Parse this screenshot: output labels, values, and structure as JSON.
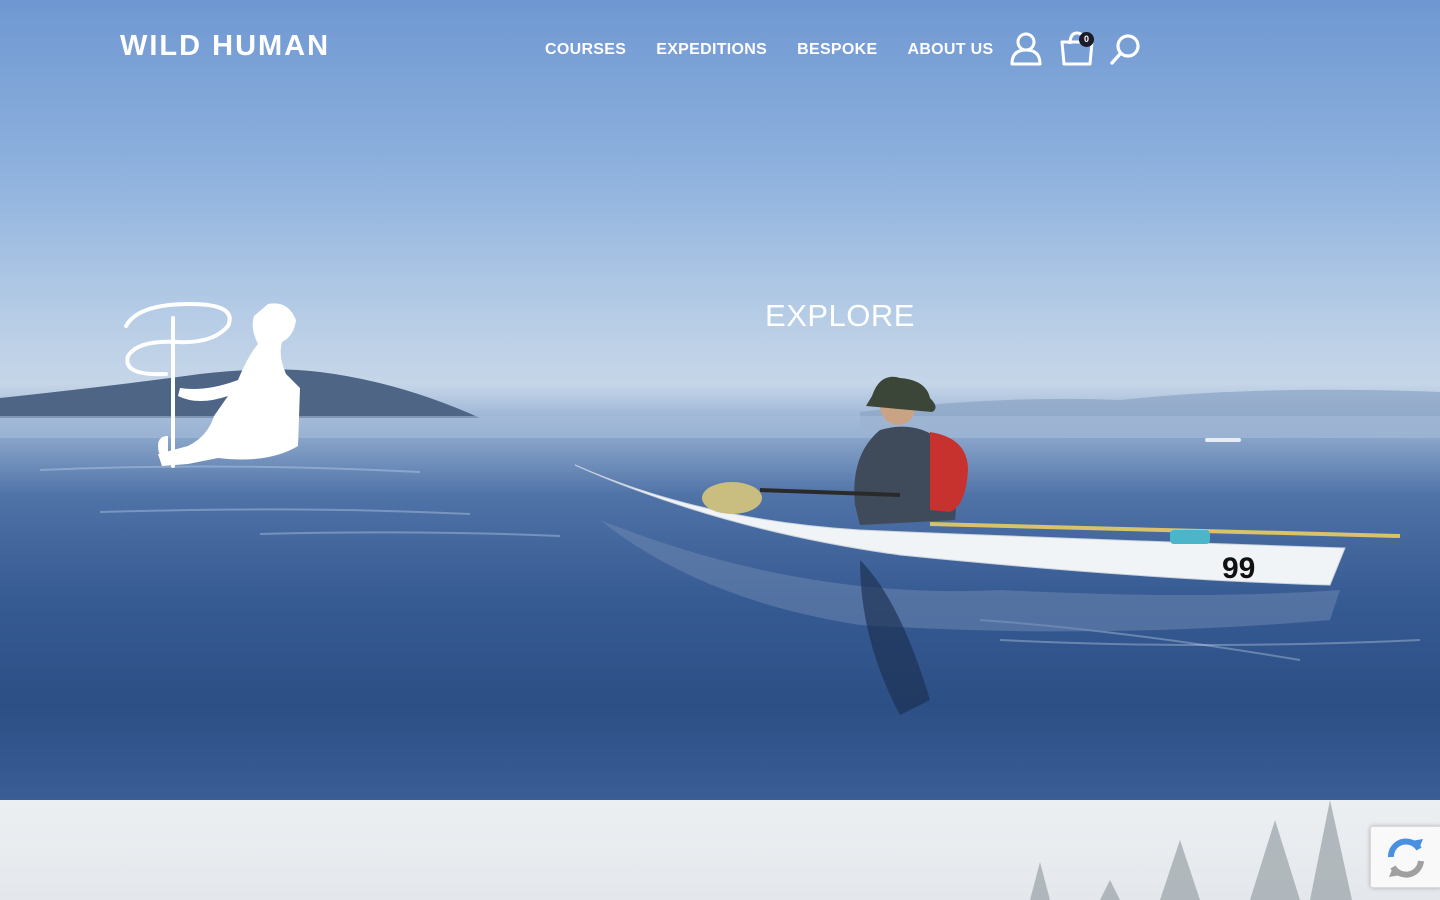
{
  "header": {
    "brand": "WILD HUMAN",
    "nav": [
      {
        "label": "COURSES"
      },
      {
        "label": "EXPEDITIONS"
      },
      {
        "label": "BESPOKE"
      },
      {
        "label": "ABOUT US"
      }
    ],
    "icons": [
      "user-icon",
      "cart-icon",
      "search-icon"
    ],
    "cart_count": "0"
  },
  "hero": {
    "headline": "EXPLORE",
    "kayak_number": "99"
  },
  "colors": {
    "sky": "#8fb2de",
    "water": "#2c4f86",
    "text": "#ffffff",
    "badge": "#1b1b2a"
  }
}
